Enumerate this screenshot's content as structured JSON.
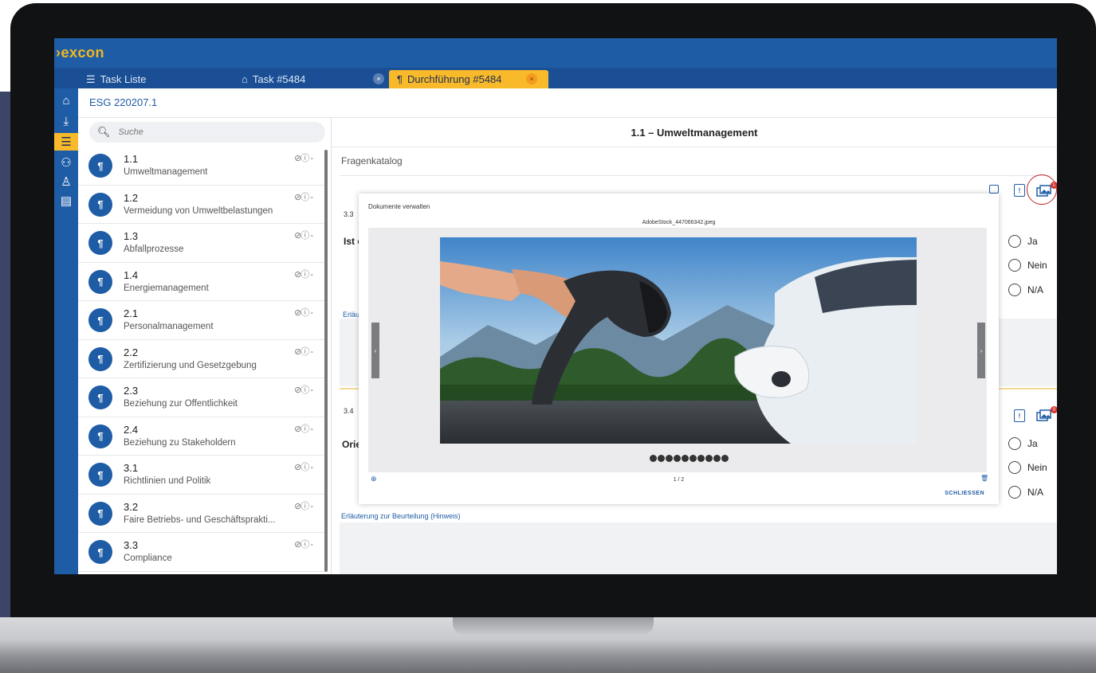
{
  "app": {
    "logo": "›excon"
  },
  "tabs": [
    {
      "label": "Task Liste",
      "icon": "list-icon"
    },
    {
      "label": "Task #5484",
      "icon": "home-icon",
      "close": "×"
    },
    {
      "label": "Durchführung #5484",
      "icon": "pilcrow-icon",
      "close": "×"
    }
  ],
  "breadcrumb": "ESG 220207.1",
  "search": {
    "placeholder": "Suche"
  },
  "items": [
    {
      "badge": "¶",
      "num": "1.1",
      "title": "Umweltmanagement",
      "status": "⊘ⓘ -"
    },
    {
      "badge": "¶",
      "num": "1.2",
      "title": "Vermeidung von Umweltbelastungen",
      "status": "⊘ⓘ -"
    },
    {
      "badge": "¶",
      "num": "1.3",
      "title": "Abfallprozesse",
      "status": "⊘ⓘ -"
    },
    {
      "badge": "¶",
      "num": "1.4",
      "title": "Energiemanagement",
      "status": "⊘ⓘ -"
    },
    {
      "badge": "¶",
      "num": "2.1",
      "title": "Personalmanagement",
      "status": "⊘ⓘ -"
    },
    {
      "badge": "¶",
      "num": "2.2",
      "title": "Zertifizierung und Gesetzgebung",
      "status": "⊘ⓘ -"
    },
    {
      "badge": "¶",
      "num": "2.3",
      "title": "Beziehung zur Öffentlichkeit",
      "status": "⊘ⓘ -"
    },
    {
      "badge": "¶",
      "num": "2.4",
      "title": "Beziehung zu Stakeholdern",
      "status": "⊘ⓘ -"
    },
    {
      "badge": "¶",
      "num": "3.1",
      "title": "Richtlinien und Politik",
      "status": "⊘ⓘ -"
    },
    {
      "badge": "¶",
      "num": "3.2",
      "title": "Faire Betriebs- und Geschäftsprakti...",
      "status": "⊘ⓘ -"
    },
    {
      "badge": "¶",
      "num": "3.3",
      "title": "Compliance",
      "status": "⊘ⓘ -"
    }
  ],
  "main": {
    "heading": "1.1 – Umweltmanagement",
    "catalog_label": "Fragenkatalog",
    "q1": {
      "num": "3.3",
      "text": "Ist c",
      "hint": "Erläu"
    },
    "q2": {
      "num": "3.4",
      "text": "Orie",
      "hint": "Erläuterung zur Beurteilung (Hinweis)"
    },
    "doc_icon_text": "!",
    "photo_badge": "0",
    "radio_options": [
      "Ja",
      "Nein",
      "N/A"
    ]
  },
  "modal": {
    "title": "Dokumente verwalten",
    "filename": "AdobeStock_447066342.jpeg",
    "pager": "1 / 2",
    "add": "⊕",
    "delete": "🗑",
    "prev": "‹",
    "next": "›",
    "close_label": "SCHLIESSEN"
  },
  "colors": {
    "primary": "#1f5ca6",
    "accent": "#f8b92a",
    "alert": "#d6332c"
  }
}
